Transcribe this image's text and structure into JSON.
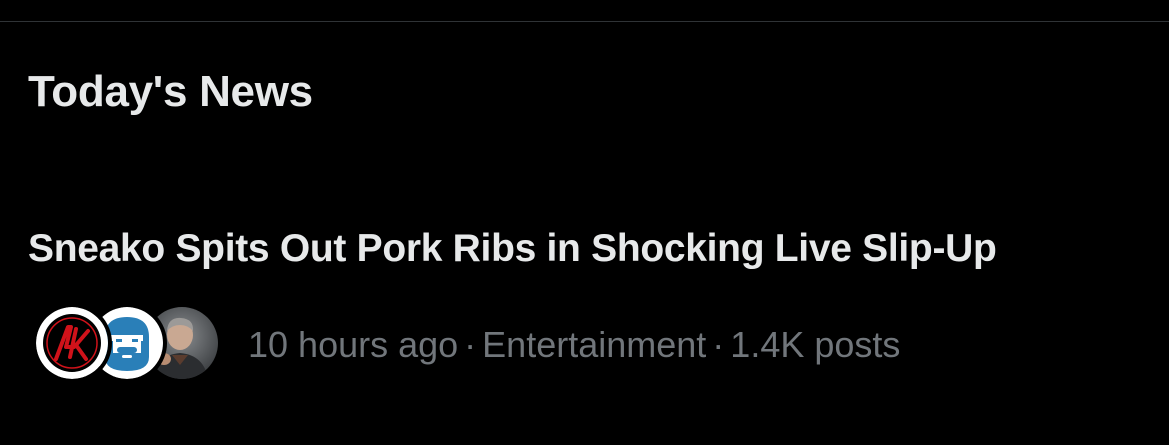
{
  "section": {
    "title": "Today's News"
  },
  "news_item": {
    "headline": "Sneako Spits Out Pork Ribs in Shocking Live Slip-Up",
    "meta": {
      "time": "10 hours ago",
      "category": "Entertainment",
      "posts": "1.4K posts",
      "separator": "·"
    },
    "avatars": [
      {
        "name": "ak-logo-avatar",
        "accent": "#d0121a"
      },
      {
        "name": "bearded-man-avatar",
        "accent": "#2a7fb8"
      },
      {
        "name": "photo-avatar",
        "accent": "#6b6f72"
      }
    ]
  },
  "colors": {
    "background": "#000000",
    "primary_text": "#e7e9ea",
    "secondary_text": "#71767b",
    "divider": "#2f3336"
  }
}
